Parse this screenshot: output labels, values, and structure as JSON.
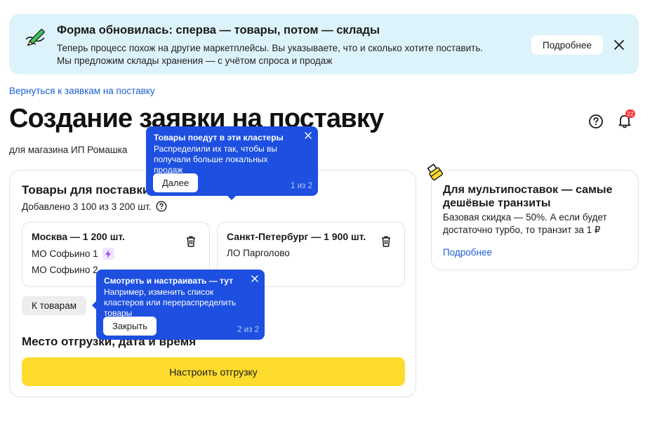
{
  "banner": {
    "title": "Форма обновилась: сперва — товары, потом — склады",
    "text_line1": "Теперь процесс похож на другие маркетплейсы. Вы указываете, что и сколько хотите поставить.",
    "text_line2": "Мы предложим склады хранения — с учётом спроса и продаж",
    "more_label": "Подробнее"
  },
  "back_link": "Вернуться к заявкам на поставку",
  "page_title": "Создание заявки на поставку",
  "store_subtitle": "для магазина ИП Ромашка",
  "notifications": {
    "badge": "22"
  },
  "goods": {
    "title": "Товары для поставки",
    "added": "Добавлено 3 100 из 3 200 шт.",
    "clusters": [
      {
        "title": "Москва — 1 200 шт.",
        "warehouses": [
          "МО Софьино 1",
          "МО Софьино 2"
        ]
      },
      {
        "title": "Санкт-Петербург — 1 900 шт.",
        "warehouses": [
          "ЛО Парголово"
        ]
      }
    ],
    "to_goods_label": "К товарам"
  },
  "shipment": {
    "title": "Место отгрузки, дата и время",
    "button_label": "Настроить отгрузку"
  },
  "promo": {
    "title": "Для мультипоставок — самые дешёвые транзиты",
    "text": "Базовая скидка — 50%. А если будет достаточно турбо, то транзит за 1 ₽",
    "link": "Подробнее"
  },
  "tooltips": [
    {
      "title": "Товары поедут в эти кластеры",
      "text": "Распределили их так, чтобы вы получали больше локальных продаж",
      "button": "Далее",
      "counter": "1 из 2"
    },
    {
      "title": "Смотреть и настраивать — тут",
      "text": "Например, изменить список кластеров или перераспределить товары",
      "button": "Закрыть",
      "counter": "2 из 2"
    }
  ],
  "colors": {
    "accent": "#1d4fe0",
    "link": "#1a5fd0",
    "primary_button": "#fddc2e",
    "banner_bg": "#ddf3fb"
  }
}
